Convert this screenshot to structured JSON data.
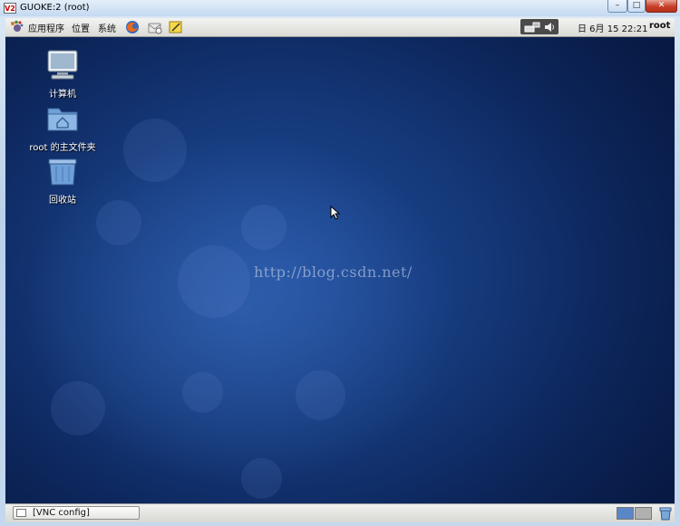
{
  "window": {
    "title": "GUOKE:2 (root)",
    "app_icon_text": "V2",
    "controls": {
      "minimize": "–",
      "maximize": "□",
      "close": "✕"
    }
  },
  "top_panel": {
    "menus": [
      "应用程序",
      "位置",
      "系统"
    ],
    "launchers": [
      "firefox-icon",
      "mail-icon",
      "notes-icon"
    ],
    "tray_icons": [
      "network-icon",
      "volume-icon"
    ],
    "clock": "日 6月 15 22:21",
    "user": "root"
  },
  "desktop": {
    "icons": [
      {
        "label": "计算机",
        "icon": "computer-icon"
      },
      {
        "label": "root 的主文件夹",
        "icon": "home-folder-icon"
      },
      {
        "label": "回收站",
        "icon": "trash-icon"
      }
    ],
    "watermark": "http://blog.csdn.net/",
    "colors": {
      "background_dark": "#0c2458",
      "background_mid": "#1f4c9a"
    }
  },
  "bottom_panel": {
    "taskbar_item": "[VNC config]",
    "workspaces": {
      "count": 2,
      "active": 1
    },
    "colors": {
      "active_workspace": "#5a86c6",
      "inactive_workspace": "#b0b0b0"
    }
  }
}
